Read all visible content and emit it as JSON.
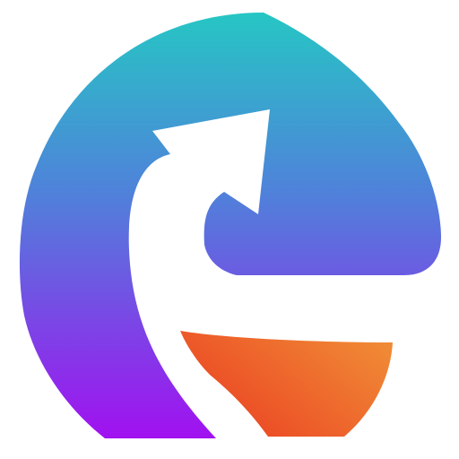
{
  "logo": {
    "name": "circular-e-arrow-logo",
    "colors": {
      "blue_purple_top": "#26C6C4",
      "blue_purple_mid": "#4F82DA",
      "blue_purple_bottom": "#A111F0",
      "orange_left": "#EB3F22",
      "orange_right": "#F08A35",
      "background": "#FFFFFF"
    }
  }
}
